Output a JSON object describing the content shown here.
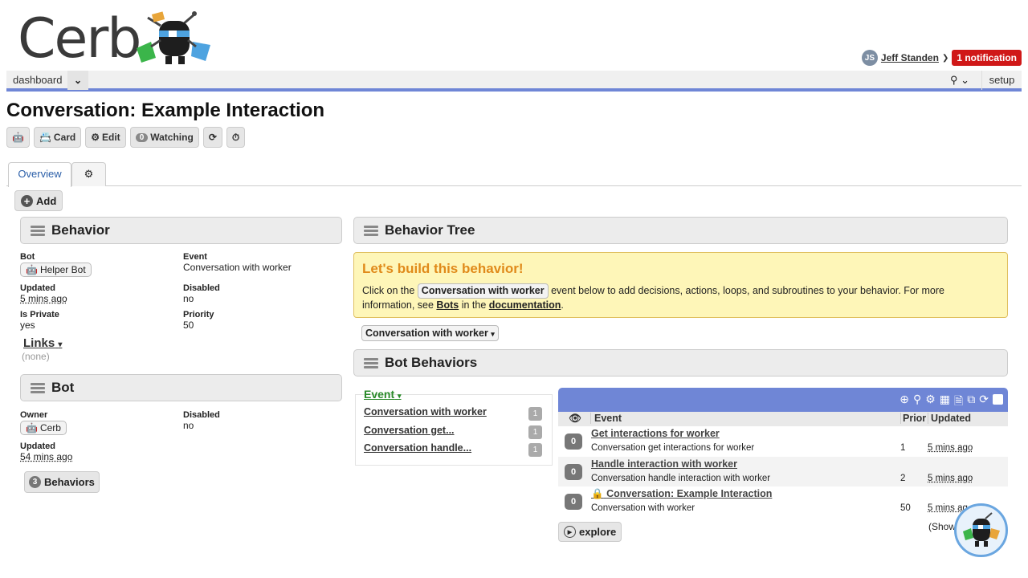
{
  "brand": {
    "logo_text": "Cerb"
  },
  "user": {
    "initials": "JS",
    "name": "Jeff Standen",
    "notifications_label": "1 notification"
  },
  "nav": {
    "dashboard_label": "dashboard",
    "setup_label": "setup"
  },
  "page": {
    "title": "Conversation: Example Interaction"
  },
  "toolbar": {
    "card_label": "Card",
    "edit_label": "Edit",
    "watching_count": "0",
    "watching_label": "Watching"
  },
  "tabs": {
    "overview_label": "Overview"
  },
  "add_label": "Add",
  "behavior_section": {
    "title": "Behavior",
    "bot_label": "Bot",
    "bot_value": "Helper Bot",
    "event_label": "Event",
    "event_value": "Conversation with worker",
    "updated_label": "Updated",
    "updated_value": "5 mins ago",
    "disabled_label": "Disabled",
    "disabled_value": "no",
    "private_label": "Is Private",
    "private_value": "yes",
    "priority_label": "Priority",
    "priority_value": "50",
    "links_label": "Links",
    "links_value": "(none)"
  },
  "bot_section": {
    "title": "Bot",
    "owner_label": "Owner",
    "owner_value": "Cerb",
    "disabled_label": "Disabled",
    "disabled_value": "no",
    "updated_label": "Updated",
    "updated_value": "54 mins ago",
    "behaviors_count": "3",
    "behaviors_label": "Behaviors"
  },
  "behavior_tree": {
    "title": "Behavior Tree",
    "help_title": "Let's build this behavior!",
    "help_text_1": "Click on the",
    "help_chip": "Conversation with worker",
    "help_text_2": "event below to add decisions, actions, loops, and subroutines to your behavior. For more information, see",
    "help_link_bots": "Bots",
    "help_text_3": "in the",
    "help_link_docs": "documentation",
    "help_text_4": ".",
    "event_dropdown": "Conversation with worker"
  },
  "bot_behaviors": {
    "title": "Bot Behaviors",
    "event_filter_label": "Event",
    "events": [
      {
        "label": "Conversation with worker",
        "count": "1"
      },
      {
        "label": "Conversation get...",
        "count": "1"
      },
      {
        "label": "Conversation handle...",
        "count": "1"
      }
    ],
    "columns": {
      "event": "Event",
      "priority": "Prior",
      "updated": "Updated"
    },
    "rows": [
      {
        "badge": "0",
        "title": "Get interactions for worker",
        "event": "Conversation get interactions for worker",
        "priority": "1",
        "updated": "5 mins ago"
      },
      {
        "badge": "0",
        "title": "Handle interaction with worker",
        "event": "Conversation handle interaction with worker",
        "priority": "2",
        "updated": "5 mins ago"
      },
      {
        "badge": "0",
        "title": "Conversation: Example Interaction",
        "event": "Conversation with worker",
        "priority": "50",
        "updated": "5 mins ag"
      }
    ],
    "showing_text": "(Show",
    "explore_label": "explore"
  },
  "colors": {
    "accent_bar": "#6f86d6",
    "help_bg": "#fef6b8",
    "help_title": "#e08a1a",
    "event_green": "#2a8a2a",
    "notification_red": "#d01818"
  }
}
